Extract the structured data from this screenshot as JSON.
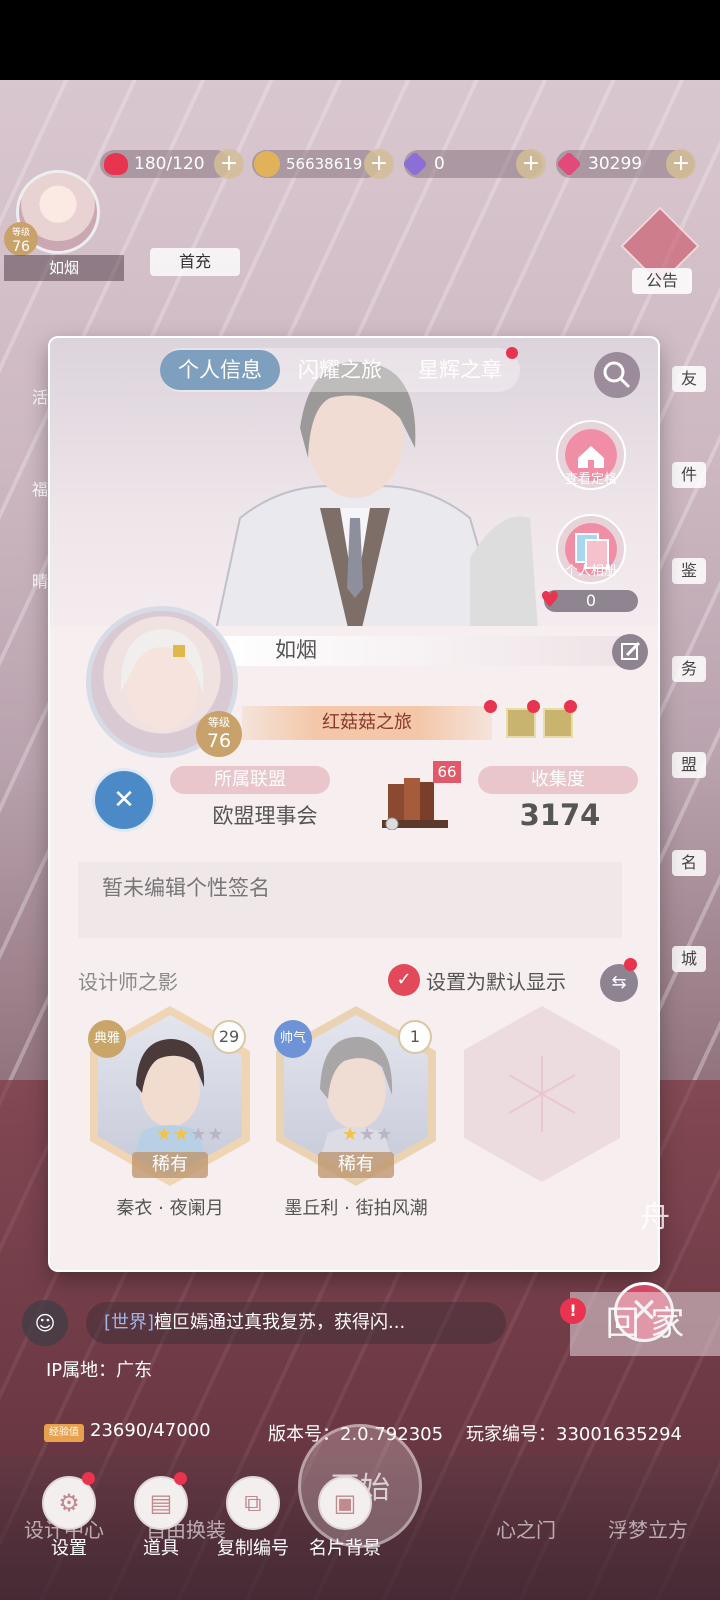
{
  "resources": {
    "stamina": "180/120",
    "gold": "56638619",
    "crystal": "0",
    "diamond": "30299",
    "plus": "+"
  },
  "player_small": {
    "level_label": "等级",
    "level": "76",
    "name": "如烟"
  },
  "recharge": "首充",
  "side_labels": [
    "公告",
    "友",
    "件",
    "鉴",
    "务",
    "盟",
    "名",
    "城"
  ],
  "left_labels": [
    "活",
    "福",
    "晴之"
  ],
  "panel": {
    "tabs": [
      {
        "label": "个人信息"
      },
      {
        "label": "闪耀之旅"
      },
      {
        "label": "星辉之章"
      }
    ],
    "view_outfit": "查看定格",
    "album": "个人相册",
    "likes": "0",
    "name": "如烟",
    "level_label": "等级",
    "level": "76",
    "journey": "红菇菇之旅",
    "alliance_label": "所属联盟",
    "alliance_name": "欧盟理事会",
    "book_count": "66",
    "collection_label": "收集度",
    "collection_value": "3174",
    "signature_placeholder": "暂未编辑个性签名",
    "designer_shadow": "设计师之影",
    "set_default": "设置为默认显示",
    "cards": [
      {
        "tag": "典雅",
        "tag_color": "#c9a56a",
        "num": "29",
        "rarity": "稀有",
        "name": "秦衣 · 夜阑月"
      },
      {
        "tag": "帅气",
        "tag_color": "#6e93d6",
        "num": "1",
        "rarity": "稀有",
        "name": "墨丘利 · 街拍风潮"
      }
    ]
  },
  "chat": {
    "channel": "[世界]",
    "message": "檀叵嫣通过真我复苏，获得闪..."
  },
  "home_label": "回 家",
  "ship_label": "舟",
  "ip": "IP属地：广东",
  "exp_tag": "经验值",
  "exp": "23690/47000",
  "version": "版本号：2.0.792305",
  "player_id": "玩家编号：33001635294",
  "bottom_bg_labels": [
    "设计中心",
    "自由换装",
    "心之门",
    "浮梦立方"
  ],
  "start_label": "开始",
  "bottom_buttons": [
    "设置",
    "道具",
    "复制编号",
    "名片背景"
  ],
  "colors": {
    "accent_red": "#e8344f",
    "tab_active": "#7f9fbe",
    "gold": "#c9a26b"
  }
}
